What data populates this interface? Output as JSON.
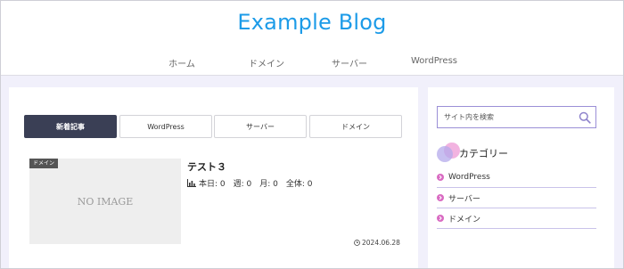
{
  "header": {
    "site_title": "Example Blog",
    "nav": [
      "ホーム",
      "ドメイン",
      "サーバー",
      "WordPress"
    ]
  },
  "main": {
    "tabs": [
      {
        "label": "新着記事",
        "active": true
      },
      {
        "label": "WordPress",
        "active": false
      },
      {
        "label": "サーバー",
        "active": false
      },
      {
        "label": "ドメイン",
        "active": false
      }
    ],
    "post": {
      "category": "ドメイン",
      "thumbnail_text": "NO IMAGE",
      "title": "テスト３",
      "stats": "本日: 0　週: 0　月: 0　全体: 0",
      "date": "2024.06.28"
    }
  },
  "sidebar": {
    "search": {
      "placeholder": "サイト内を検索",
      "value": ""
    },
    "widget_title": "カテゴリー",
    "categories": [
      "WordPress",
      "サーバー",
      "ドメイン"
    ]
  },
  "colors": {
    "brand": "#1c9be8",
    "active_tab": "#3a3f55",
    "page_bg": "#f1f0fb",
    "accent_purple": "#9b8fd6",
    "accent_pink": "#d96ac2"
  },
  "icons": {
    "search": "search-icon",
    "stats": "bar-chart-icon",
    "date": "clock-icon",
    "category_bullet": "chevron-circle-icon"
  }
}
